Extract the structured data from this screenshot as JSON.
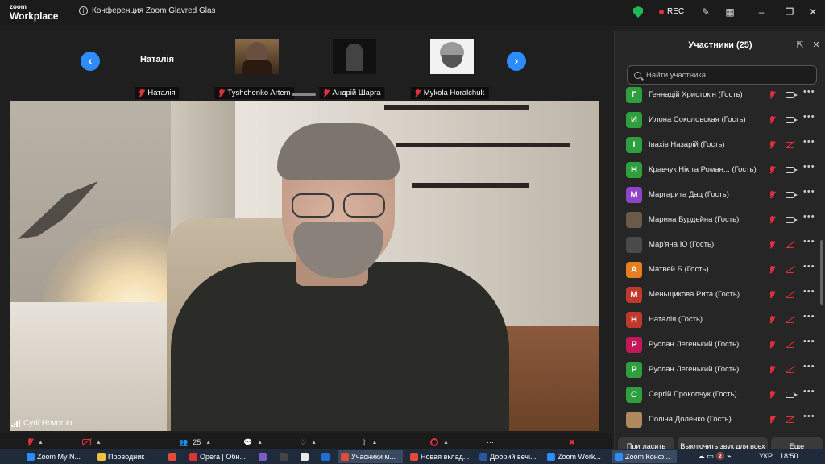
{
  "titlebar": {
    "brand_top": "zoom",
    "brand_bottom": "Workplace",
    "meeting_title": "Конференция Zoom Glavred Glas",
    "rec_label": "REC",
    "icons": [
      "info-icon",
      "shield-icon",
      "record-icon",
      "magic-wand-icon",
      "apps-icon",
      "minimize-icon",
      "restore-icon",
      "close-icon"
    ]
  },
  "filmstrip": {
    "tiles": [
      {
        "name": "Наталія",
        "label": "Наталія",
        "has_video": false
      },
      {
        "name": "Tyshchenko Artem",
        "label": "Tyshchenko Artem",
        "has_video": true
      },
      {
        "name": "Андрій Шарга",
        "label": "Андрій Шарга",
        "has_video": true
      },
      {
        "name": "Mykola Horalchuk",
        "label": "Mykola Horalchuk",
        "has_video": true
      }
    ]
  },
  "main_video": {
    "speaker_name": "Cyril Hovorun"
  },
  "panel": {
    "title": "Участники (25)",
    "search_placeholder": "Найти участника",
    "participants": [
      {
        "initial": "Г",
        "color": "#2e9e3e",
        "name": "Геннадій Христокін (Гость)",
        "camera": "on"
      },
      {
        "initial": "И",
        "color": "#2e9e3e",
        "name": "Илона Соколовская (Гость)",
        "camera": "on"
      },
      {
        "initial": "І",
        "color": "#2e9e3e",
        "name": "Івахів Назарій (Гость)",
        "camera": "off"
      },
      {
        "initial": "Н",
        "color": "#2e9e3e",
        "name": "Кравчук Нікіта  Роман...  (Гость)",
        "camera": "on"
      },
      {
        "initial": "М",
        "color": "#8e44c8",
        "name": "Маргарита Дац (Гость)",
        "camera": "on"
      },
      {
        "initial": "",
        "color": "#6b5a4a",
        "name": "Марина Бурдейна (Гость)",
        "camera": "on"
      },
      {
        "initial": "",
        "color": "#4a4a4a",
        "name": "Мар'яна Ю (Гость)",
        "camera": "off"
      },
      {
        "initial": "А",
        "color": "#e67e22",
        "name": "Матвей Б (Гость)",
        "camera": "off"
      },
      {
        "initial": "М",
        "color": "#c0392b",
        "name": "Меньщикова Рита (Гость)",
        "camera": "off"
      },
      {
        "initial": "Н",
        "color": "#c0392b",
        "name": "Наталія (Гость)",
        "camera": "off"
      },
      {
        "initial": "Р",
        "color": "#c2185b",
        "name": "Руслан Легенький (Гость)",
        "camera": "off"
      },
      {
        "initial": "Р",
        "color": "#2e9e3e",
        "name": "Руслан Легенький (Гость)",
        "camera": "off"
      },
      {
        "initial": "С",
        "color": "#2e9e3e",
        "name": "Сергій Прокопчук (Гость)",
        "camera": "on"
      },
      {
        "initial": "",
        "color": "#b08860",
        "name": "Поліна Доленко (Гость)",
        "camera": "off"
      }
    ],
    "buttons": {
      "invite": "Пригласить",
      "mute_all": "Выключить звук для всех",
      "more": "Еще"
    }
  },
  "toolbar": {
    "participants_count": "25"
  },
  "taskbar": {
    "items": [
      {
        "label": "Zoom My N...",
        "color": "#2d8cff"
      },
      {
        "label": "Проводник",
        "color": "#f0c040"
      },
      {
        "label": "",
        "color": "#e44a3a"
      },
      {
        "label": "Opera | Обн...",
        "color": "#e0303b"
      },
      {
        "label": "",
        "color": "#7a5cc8"
      },
      {
        "label": "",
        "color": "#444"
      },
      {
        "label": "",
        "color": "#e8e8e8"
      },
      {
        "label": "",
        "color": "#1e6fd0"
      },
      {
        "label": "Учасники м...",
        "color": "#e44a3a",
        "active": true
      },
      {
        "label": "Новая вклад...",
        "color": "#e44a3a"
      },
      {
        "label": "Добрий вечі...",
        "color": "#2b579a"
      },
      {
        "label": "Zoom Work...",
        "color": "#2d8cff"
      },
      {
        "label": "Zoom Конф...",
        "color": "#2d8cff",
        "active": true
      }
    ],
    "lang": "УКР",
    "time": "18:50"
  }
}
